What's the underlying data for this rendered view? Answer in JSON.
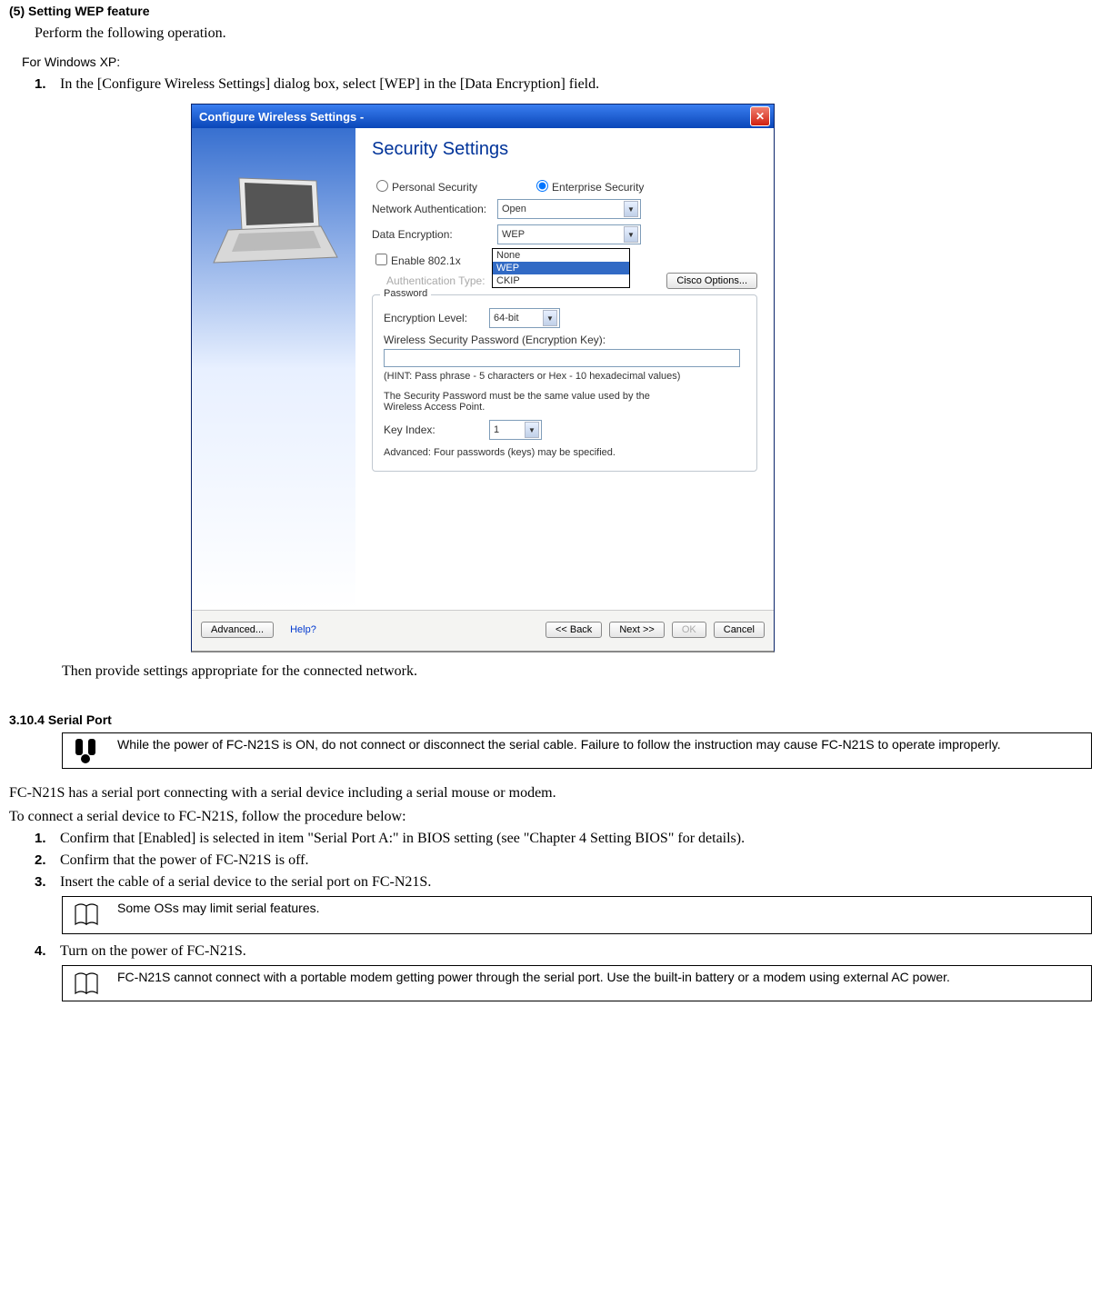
{
  "h1": "(5) Setting WEP feature",
  "intro": "Perform the following operation.",
  "subhead": "For Windows XP:",
  "step1_num": "1.",
  "step1_text": "In the [Configure Wireless Settings] dialog box, select [WEP] in the [Data Encryption] field.",
  "step1_followup": "Then provide settings appropriate for the connected network.",
  "sec2_heading": "3.10.4    Serial Port",
  "warn1": "While the power of FC-N21S is ON, do not connect or disconnect the serial cable. Failure to follow the instruction may cause FC-N21S to operate improperly.",
  "para1": "FC-N21S has a serial port connecting with a serial device including a serial mouse or modem.",
  "para2": "To connect a serial device to FC-N21S, follow the procedure below:",
  "s1_num": "1.",
  "s1_text": "Confirm that [Enabled] is selected in item \"Serial Port A:\" in BIOS setting (see \"Chapter 4 Setting BIOS\" for details).",
  "s2_num": "2.",
  "s2_text": "Confirm that the power of FC-N21S is off.",
  "s3_num": "3.",
  "s3_text": "Insert the cable of a serial device to the serial port on FC-N21S.",
  "note2": "Some OSs may limit serial features.",
  "s4_num": "4.",
  "s4_text": "Turn on the power of FC-N21S.",
  "note3": "FC-N21S cannot connect with a portable modem getting power through the serial port. Use the built-in battery or a modem using external AC power.",
  "dialog": {
    "title": "Configure Wireless Settings  -",
    "panel_title": "Security Settings",
    "radio_personal": "Personal Security",
    "radio_enterprise": "Enterprise Security",
    "lbl_netauth": "Network Authentication:",
    "val_netauth": "Open",
    "lbl_dataenc": "Data Encryption:",
    "val_dataenc": "WEP",
    "enc_opt_none": "None",
    "enc_opt_wep": "WEP",
    "enc_opt_ckip": "CKIP",
    "chk_8021x": "Enable 802.1x",
    "lbl_authtype": "Authentication Type:",
    "btn_cisco": "Cisco Options...",
    "legend_password": "Password",
    "lbl_enclevel": "Encryption Level:",
    "val_enclevel": "64-bit",
    "lbl_passkey": "Wireless Security Password (Encryption Key):",
    "hint": "(HINT: Pass phrase - 5 characters or Hex - 10 hexadecimal values)",
    "sp_note": "The Security Password must be the same value used by the Wireless Access Point.",
    "lbl_keyindex": "Key Index:",
    "val_keyindex": "1",
    "adv_note": "Advanced: Four passwords (keys) may be specified.",
    "btn_advanced": "Advanced...",
    "link_help": "Help?",
    "btn_back": "<<  Back",
    "btn_next": "Next >>",
    "btn_ok": "OK",
    "btn_cancel": "Cancel"
  }
}
